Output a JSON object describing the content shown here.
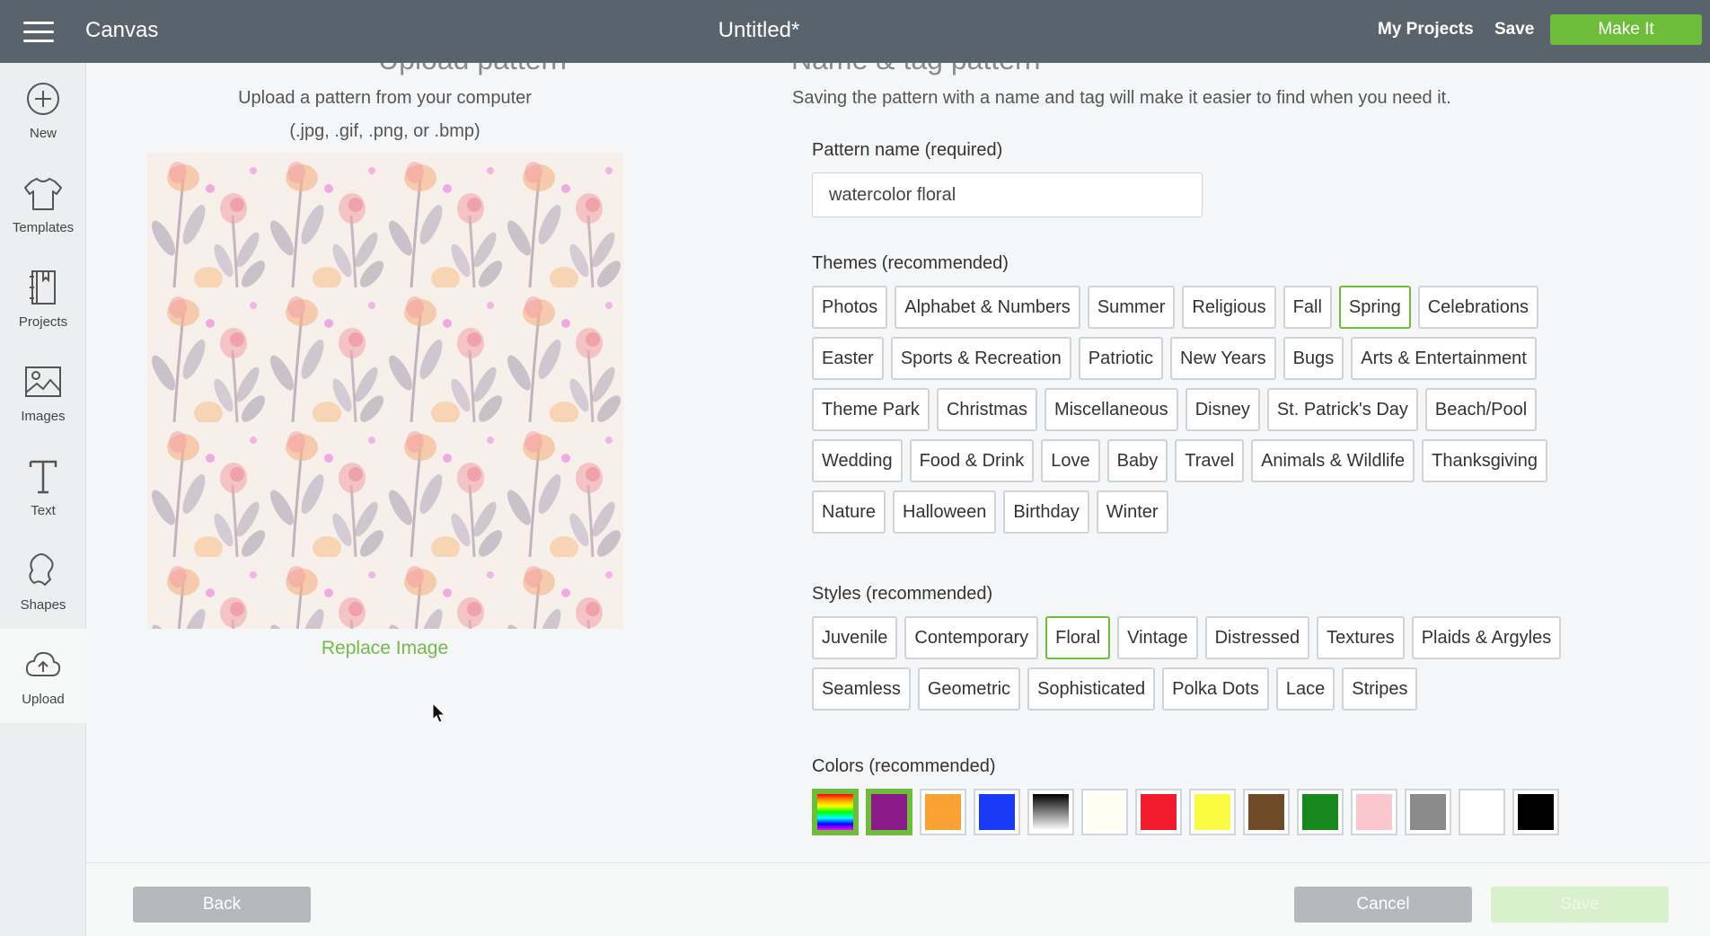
{
  "topbar": {
    "app_name": "Canvas",
    "doc_title": "Untitled*",
    "my_projects": "My Projects",
    "save": "Save",
    "make_it": "Make It"
  },
  "sidebar": {
    "items": [
      {
        "label": "New",
        "icon": "plus-circle-icon"
      },
      {
        "label": "Templates",
        "icon": "tshirt-icon"
      },
      {
        "label": "Projects",
        "icon": "book-icon"
      },
      {
        "label": "Images",
        "icon": "image-icon"
      },
      {
        "label": "Text",
        "icon": "text-icon"
      },
      {
        "label": "Shapes",
        "icon": "shapes-icon"
      },
      {
        "label": "Upload",
        "icon": "cloud-upload-icon"
      }
    ],
    "active": "Upload"
  },
  "upload": {
    "heading": "Upload pattern",
    "subtitle_line1": "Upload a pattern from your computer",
    "subtitle_line2": "(.jpg, .gif, .png, or .bmp)",
    "replace_label": "Replace Image"
  },
  "form": {
    "heading": "Name & tag pattern",
    "subtitle": "Saving the pattern with a name and tag will make it easier to find when you need it.",
    "name_label": "Pattern name (required)",
    "name_value": "watercolor floral",
    "themes_label": "Themes (recommended)",
    "themes": [
      "Photos",
      "Alphabet & Numbers",
      "Summer",
      "Religious",
      "Fall",
      "Spring",
      "Celebrations",
      "Easter",
      "Sports & Recreation",
      "Patriotic",
      "New Years",
      "Bugs",
      "Arts & Entertainment",
      "Theme Park",
      "Christmas",
      "Miscellaneous",
      "Disney",
      "St. Patrick's Day",
      "Beach/Pool",
      "Wedding",
      "Food & Drink",
      "Love",
      "Baby",
      "Travel",
      "Animals & Wildlife",
      "Thanksgiving",
      "Nature",
      "Halloween",
      "Birthday",
      "Winter"
    ],
    "themes_selected": [
      "Spring"
    ],
    "styles_label": "Styles (recommended)",
    "styles": [
      "Juvenile",
      "Contemporary",
      "Floral",
      "Vintage",
      "Distressed",
      "Textures",
      "Plaids & Argyles",
      "Seamless",
      "Geometric",
      "Sophisticated",
      "Polka Dots",
      "Lace",
      "Stripes"
    ],
    "styles_selected": [
      "Floral"
    ],
    "colors_label": "Colors (recommended)",
    "colors": [
      {
        "name": "multicolor",
        "value": "linear-gradient(180deg,#ff0000,#ff9900,#ffff00,#00ff00,#00ffff,#0000ff,#ff00ff)",
        "selected": true
      },
      {
        "name": "purple",
        "value": "#8b1a89",
        "selected": true
      },
      {
        "name": "orange",
        "value": "#faa334",
        "selected": false
      },
      {
        "name": "blue",
        "value": "#1a3bf5",
        "selected": false
      },
      {
        "name": "gray-gradient",
        "value": "linear-gradient(180deg,#000000,#ffffff)",
        "selected": false
      },
      {
        "name": "cream",
        "value": "#fffef0",
        "selected": false
      },
      {
        "name": "red",
        "value": "#f11b2b",
        "selected": false
      },
      {
        "name": "yellow",
        "value": "#fbfb44",
        "selected": false
      },
      {
        "name": "brown",
        "value": "#6e4a26",
        "selected": false
      },
      {
        "name": "green",
        "value": "#18871e",
        "selected": false
      },
      {
        "name": "pink",
        "value": "#fbc7cf",
        "selected": false
      },
      {
        "name": "gray",
        "value": "#8a8a8a",
        "selected": false
      },
      {
        "name": "white",
        "value": "#ffffff",
        "selected": false
      },
      {
        "name": "black",
        "value": "#000000",
        "selected": false
      }
    ]
  },
  "footer": {
    "back": "Back",
    "cancel": "Cancel",
    "save": "Save"
  },
  "colors": {
    "accent": "#6dbd3b",
    "topbar": "#59636b"
  }
}
